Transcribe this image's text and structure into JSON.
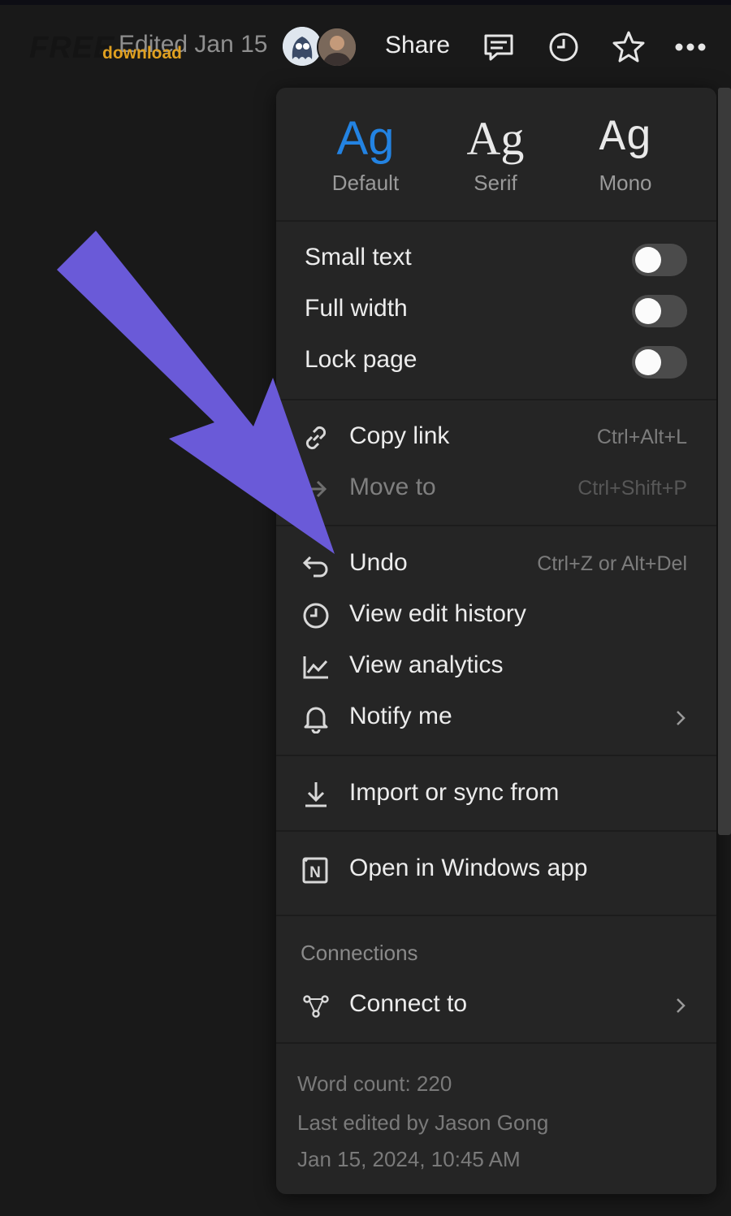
{
  "header": {
    "watermark_main": "FREE",
    "watermark_sub": "download",
    "edited": "Edited Jan 15",
    "share": "Share",
    "icons": [
      "comment-icon",
      "clock-icon",
      "star-icon",
      "more-icon"
    ]
  },
  "fonts": [
    {
      "sample": "Ag",
      "label": "Default",
      "active": true
    },
    {
      "sample": "Ag",
      "label": "Serif",
      "active": false
    },
    {
      "sample": "Ag",
      "label": "Mono",
      "active": false
    }
  ],
  "toggles": [
    {
      "label": "Small text",
      "on": false
    },
    {
      "label": "Full width",
      "on": false
    },
    {
      "label": "Lock page",
      "on": false
    }
  ],
  "actions1": [
    {
      "label": "Copy link",
      "shortcut": "Ctrl+Alt+L",
      "icon": "link-icon",
      "disabled": false
    },
    {
      "label": "Move to",
      "shortcut": "Ctrl+Shift+P",
      "icon": "arrow-right-icon",
      "disabled": true
    }
  ],
  "actions2": [
    {
      "label": "Undo",
      "shortcut": "Ctrl+Z or Alt+Del",
      "icon": "undo-icon"
    },
    {
      "label": "View edit history",
      "icon": "clock-icon"
    },
    {
      "label": "View analytics",
      "icon": "chart-icon"
    },
    {
      "label": "Notify me",
      "icon": "bell-icon",
      "submenu": true
    }
  ],
  "import": {
    "label": "Import or sync from",
    "icon": "download-icon"
  },
  "open_app": {
    "label": "Open in Windows app",
    "icon": "notion-logo-icon"
  },
  "connections": {
    "heading": "Connections",
    "item": {
      "label": "Connect to",
      "icon": "connections-icon",
      "submenu": true
    }
  },
  "footer": {
    "word_count": "Word count: 220",
    "last_edited": "Last edited by Jason Gong",
    "date": "Jan 15, 2024, 10:45 AM"
  },
  "colors": {
    "accent": "#2383e2",
    "annotation_arrow": "#6a5ad8",
    "menu_bg": "#252525",
    "page_bg": "#191919"
  }
}
